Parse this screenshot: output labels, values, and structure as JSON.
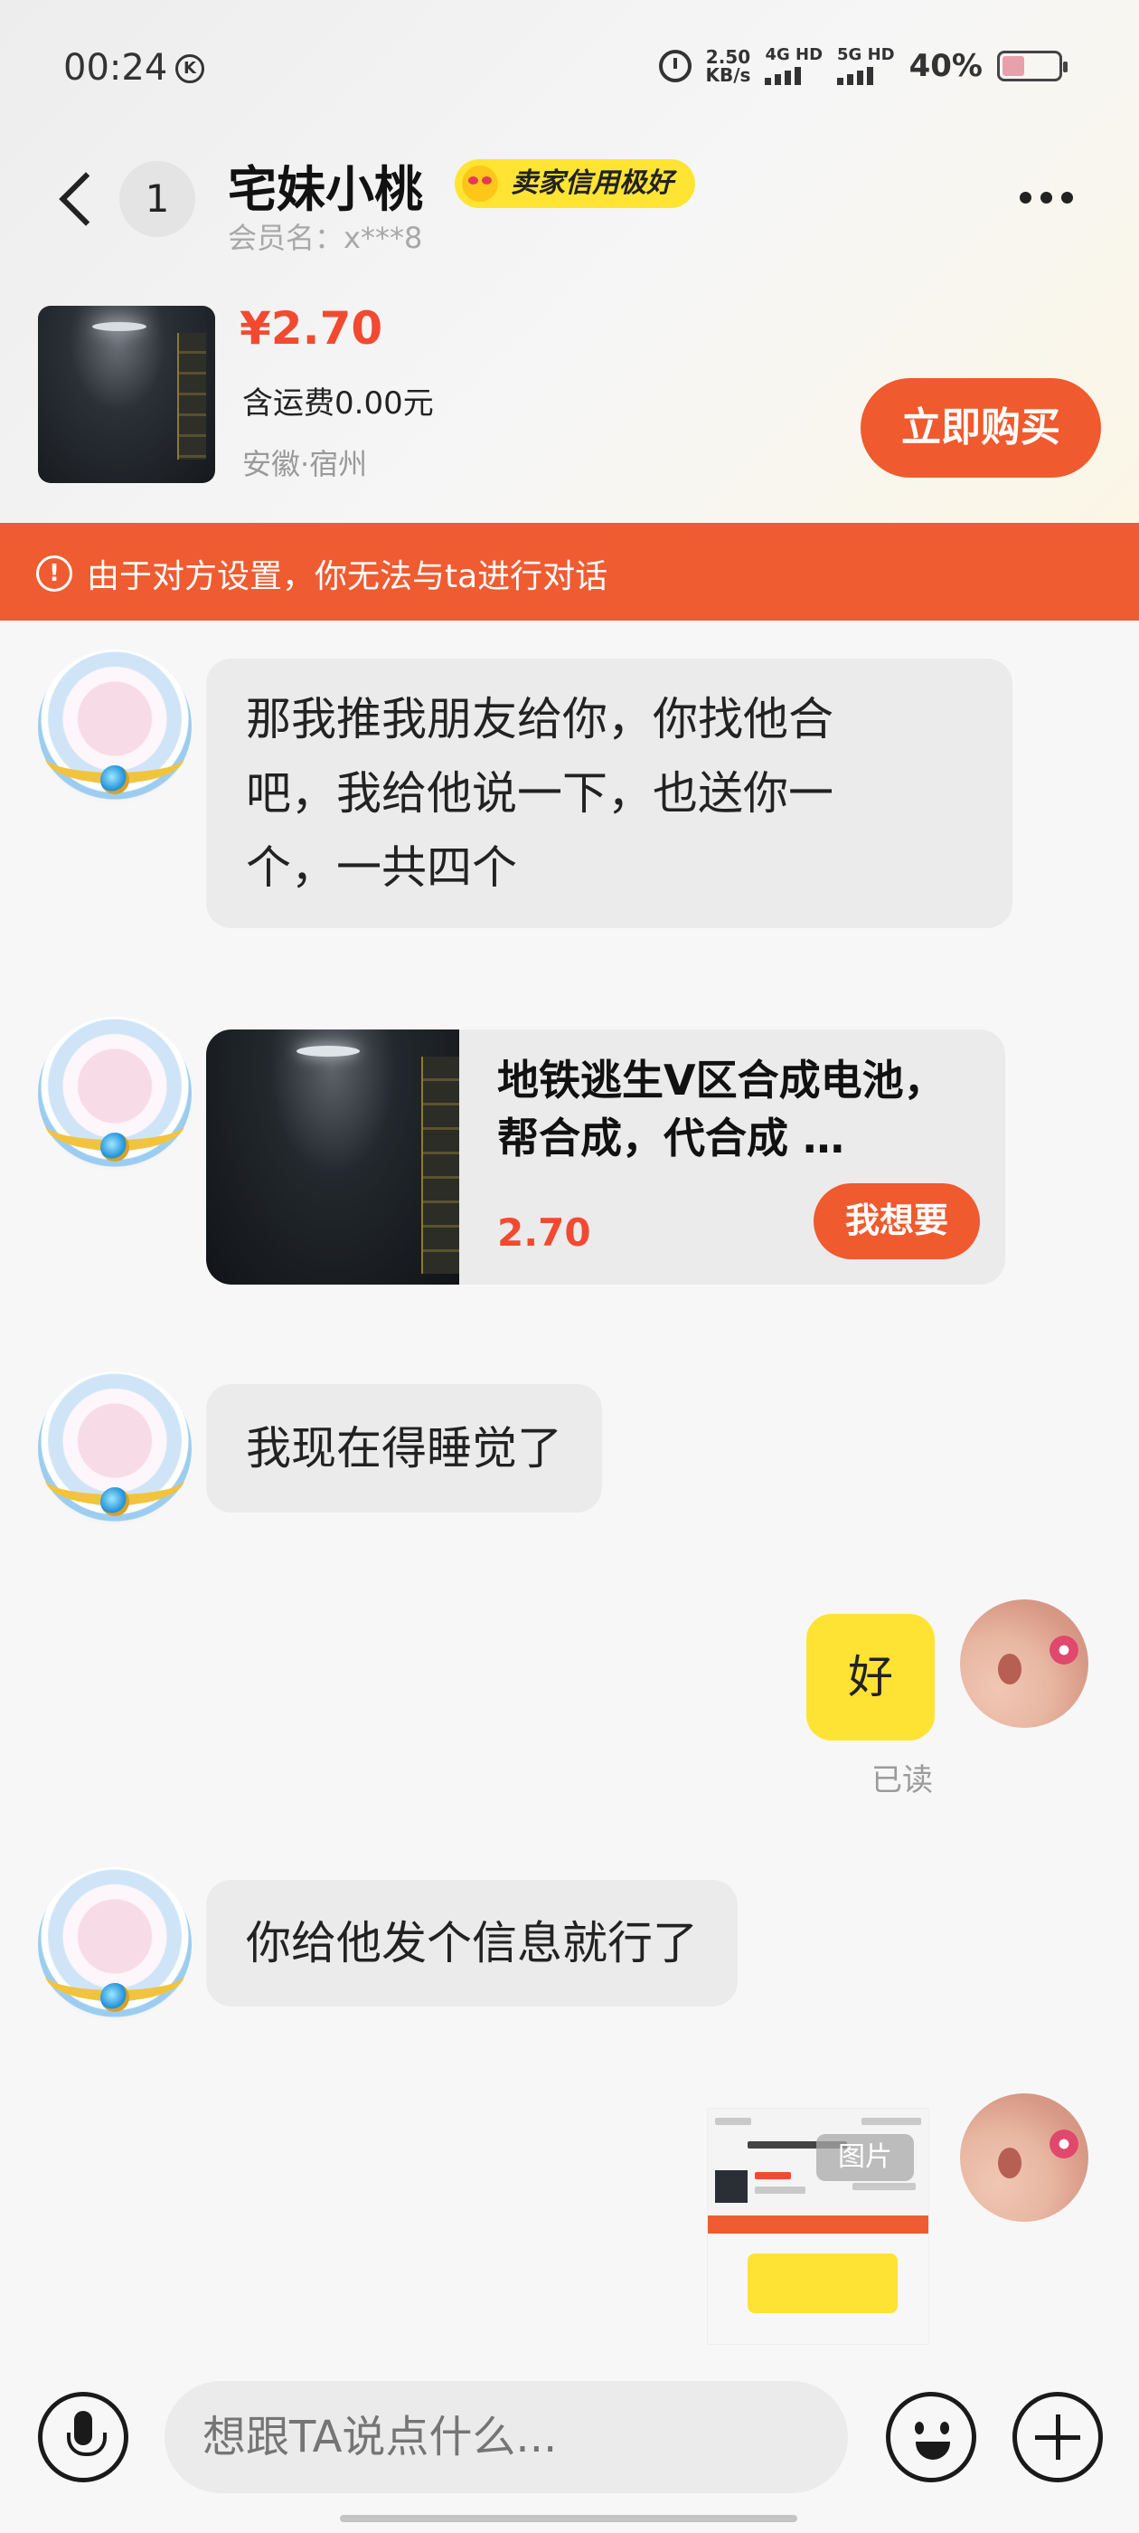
{
  "status_bar": {
    "time": "00:24",
    "k_icon": "K",
    "speed_value": "2.50",
    "speed_unit": "KB/s",
    "network_1": "4G HD",
    "network_2": "5G HD",
    "battery": "40%"
  },
  "header": {
    "unread_count": "1",
    "seller_name": "宅妹小桃",
    "credit_badge": "卖家信用极好",
    "member_name": "会员名：x***8"
  },
  "product": {
    "price": "¥2.70",
    "shipping": "含运费0.00元",
    "location": "安徽·宿州",
    "buy_label": "立即购买"
  },
  "notice": {
    "icon": "!",
    "text": "由于对方设置，你无法与ta进行对话"
  },
  "messages": {
    "m1": {
      "line1": "那我推我朋友给你，你找他合",
      "line2": "吧，我给他说一下，也送你一",
      "line3": "个，一共四个"
    },
    "card": {
      "title": "地铁逃生V区合成电池，帮合成，代合成 …",
      "price": "2.70",
      "want_label": "我想要"
    },
    "m3": "我现在得睡觉了",
    "m4": "好",
    "m4_status": "已读",
    "m5": "你给他发个信息就行了",
    "image_tag": "图片"
  },
  "input": {
    "placeholder": "想跟TA说点什么..."
  },
  "colors": {
    "accent_orange": "#ef5a2e",
    "price_red": "#f24a31",
    "my_bubble": "#ffe334",
    "their_bubble": "#ebebeb"
  },
  "icons": [
    "back-icon",
    "more-icon",
    "alert-icon",
    "microphone-icon",
    "emoji-icon",
    "plus-icon",
    "alarm-icon",
    "battery-icon"
  ]
}
